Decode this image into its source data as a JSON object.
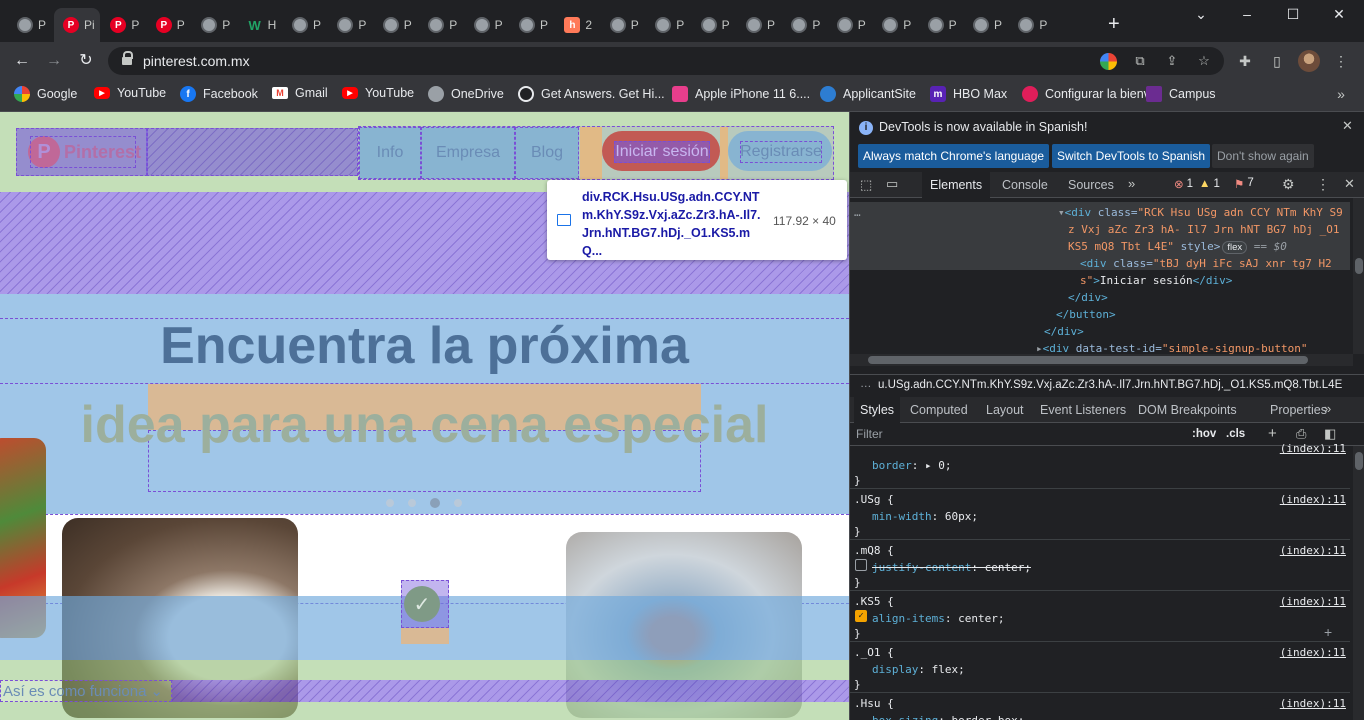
{
  "tabs": [
    {
      "label": "P",
      "icon": "globe-icon"
    },
    {
      "label": "Pi",
      "icon": "pinterest-icon",
      "active": true
    },
    {
      "label": "P",
      "icon": "pinterest-icon"
    },
    {
      "label": "P",
      "icon": "pinterest-icon"
    },
    {
      "label": "P",
      "icon": "globe-icon"
    },
    {
      "label": "H",
      "icon": "w-icon"
    },
    {
      "label": "P",
      "icon": "globe-icon"
    },
    {
      "label": "P",
      "icon": "globe-icon"
    },
    {
      "label": "P",
      "icon": "globe-icon"
    },
    {
      "label": "P",
      "icon": "globe-icon"
    },
    {
      "label": "P",
      "icon": "globe-icon"
    },
    {
      "label": "P",
      "icon": "globe-icon"
    },
    {
      "label": "2",
      "icon": "hubspot-icon"
    },
    {
      "label": "P",
      "icon": "globe-icon"
    },
    {
      "label": "P",
      "icon": "globe-icon"
    },
    {
      "label": "P",
      "icon": "globe-icon"
    },
    {
      "label": "P",
      "icon": "globe-icon"
    },
    {
      "label": "P",
      "icon": "globe-icon"
    },
    {
      "label": "P",
      "icon": "globe-icon"
    },
    {
      "label": "P",
      "icon": "globe-icon"
    },
    {
      "label": "P",
      "icon": "globe-icon"
    },
    {
      "label": "P",
      "icon": "globe-icon"
    },
    {
      "label": "P",
      "icon": "globe-icon"
    }
  ],
  "address_bar": {
    "url": "pinterest.com.mx"
  },
  "bookmarks": [
    {
      "label": "Google",
      "icon": "google-icon",
      "color": "#4285f4"
    },
    {
      "label": "YouTube",
      "icon": "youtube-icon",
      "color": "#ff0000"
    },
    {
      "label": "Facebook",
      "icon": "facebook-icon",
      "color": "#1877f2"
    },
    {
      "label": "Gmail",
      "icon": "gmail-icon",
      "color": "#ea4335"
    },
    {
      "label": "YouTube",
      "icon": "youtube-icon",
      "color": "#ff0000"
    },
    {
      "label": "OneDrive",
      "icon": "globe-icon",
      "color": "#9aa0a6"
    },
    {
      "label": "Get Answers. Get Hi...",
      "icon": "answers-icon",
      "color": "#202124"
    },
    {
      "label": "Apple iPhone 11 6....",
      "icon": "apple-store-icon",
      "color": "#e83e8c"
    },
    {
      "label": "ApplicantSite",
      "icon": "applicant-icon",
      "color": "#2d7dd2"
    },
    {
      "label": "HBO Max",
      "icon": "hbo-icon",
      "color": "#5822b4"
    },
    {
      "label": "Configurar la bienv...",
      "icon": "slack-icon",
      "color": "#e01e5a"
    },
    {
      "label": "Campus",
      "icon": "campus-icon",
      "color": "#6b2c91"
    }
  ],
  "page": {
    "logo_text": "Pinterest",
    "nav": [
      "Info",
      "Empresa",
      "Blog"
    ],
    "login_button": "Iniciar sesión",
    "signup_button": "Registrarse",
    "headline_1": "Encuentra la próxima",
    "headline_2": "idea para una cena especial",
    "how_it_works": "Así es como funciona",
    "carousel_active_index": 2,
    "carousel_dots": 4
  },
  "tooltip": {
    "selector": "div.RCK.Hsu.USg.adn.CCY.NTm.KhY.S9z.Vxj.aZc.Zr3.hA-.Il7.Jrn.hNT.BG7.hDj._O1.KS5.mQ...",
    "size": "117.92 × 40"
  },
  "devtools": {
    "info_text": "DevTools is now available in Spanish!",
    "btn_match": "Always match Chrome's language",
    "btn_switch": "Switch DevTools to Spanish",
    "btn_dismiss": "Don't show again",
    "tabs": [
      "Elements",
      "Console",
      "Sources"
    ],
    "errors": "1",
    "warnings": "1",
    "issues": "7",
    "dom": {
      "line1_tag": "<div ",
      "line1_attr": "class=",
      "line1_val": "\"RCK Hsu USg adn CCY NTm KhY S9",
      "line2_val": "z Vxj aZc Zr3 hA- Il7 Jrn hNT BG7 hDj _O1",
      "line3_val": "KS5 mQ8 Tbt L4E\"",
      "line3_style": " style>",
      "flex_badge": "flex",
      "dollar": " == $0",
      "line4_tag": "<div ",
      "line4_attr": "class=",
      "line4_val": "\"tBJ dyH iFc sAJ xnr tg7 H2",
      "line5_val": "s\"",
      "line5_text": "Iniciar sesión",
      "line5_close": "</div>",
      "line6": "</div>",
      "line7": "</button>",
      "line8": "</div>",
      "line9_tag": "<div ",
      "line9_attr": "data-test-id=",
      "line9_val": "\"simple-signup-button\""
    },
    "breadcrumb": "u.USg.adn.CCY.NTm.KhY.S9z.Vxj.aZc.Zr3.hA-.Il7.Jrn.hNT.BG7.hDj._O1.KS5.mQ8.Tbt.L4E",
    "sub_tabs": [
      "Styles",
      "Computed",
      "Layout",
      "Event Listeners",
      "DOM Breakpoints",
      "Properties"
    ],
    "filter_placeholder": "Filter",
    "hov": ":hov",
    "cls": ".cls",
    "rules": [
      {
        "selector": "",
        "source": "(index):11",
        "props": [
          {
            "name": "border",
            "value": ": ▸ 0;"
          }
        ]
      },
      {
        "selector": ".USg {",
        "source": "(index):11",
        "props": [
          {
            "name": "min-width",
            "value": ": 60px;"
          }
        ]
      },
      {
        "selector": ".mQ8 {",
        "source": "(index):11",
        "props": [
          {
            "name": "justify-content",
            "value": ": center;",
            "struck": true
          }
        ]
      },
      {
        "selector": ".KS5 {",
        "source": "(index):11",
        "props": [
          {
            "name": "align-items",
            "value": ": center;",
            "checked": true
          }
        ]
      },
      {
        "selector": "._O1 {",
        "source": "(index):11",
        "props": [
          {
            "name": "display",
            "value": ": flex;"
          }
        ]
      },
      {
        "selector": ".Hsu {",
        "source": "(index):11",
        "props": [
          {
            "name": "box-sizing",
            "value": ": border-box;"
          }
        ]
      }
    ]
  }
}
